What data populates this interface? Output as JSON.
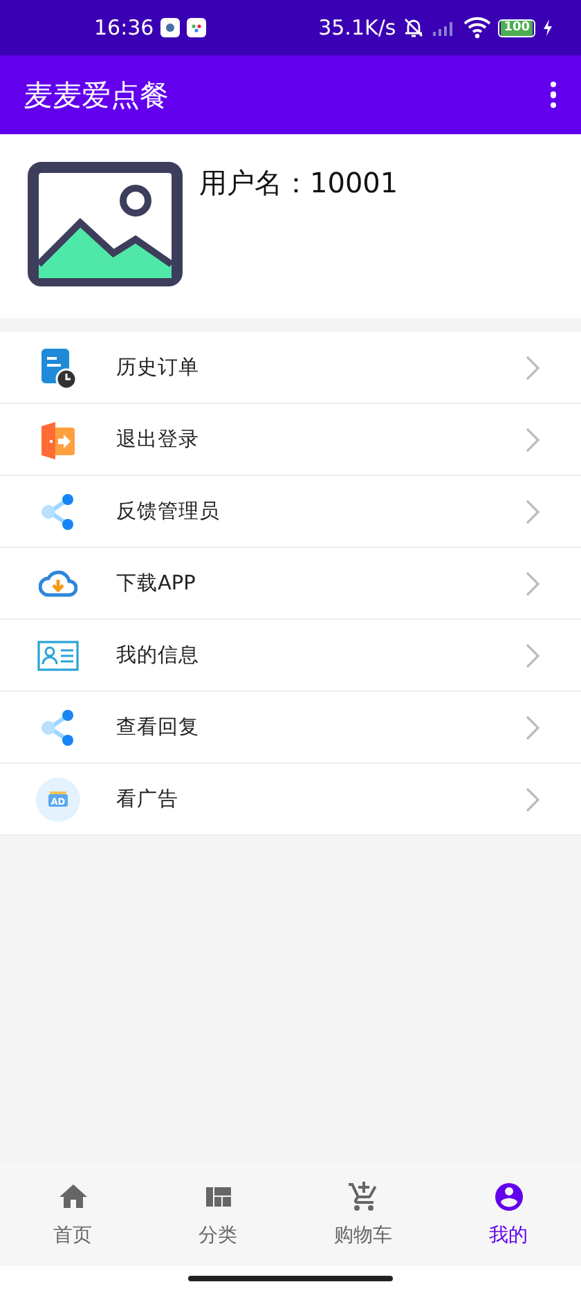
{
  "status_bar": {
    "time": "16:36",
    "speed": "35.1K/s",
    "battery": "100"
  },
  "app_bar": {
    "title": "麦麦爱点餐"
  },
  "profile": {
    "username": "用户名：10001"
  },
  "menu": [
    {
      "label": "历史订单"
    },
    {
      "label": "退出登录"
    },
    {
      "label": "反馈管理员"
    },
    {
      "label": "下载APP"
    },
    {
      "label": "我的信息"
    },
    {
      "label": "查看回复"
    },
    {
      "label": "看广告",
      "icon_text": "AD"
    }
  ],
  "bottom_nav": [
    {
      "label": "首页",
      "selected": false
    },
    {
      "label": "分类",
      "selected": false
    },
    {
      "label": "购物车",
      "selected": false
    },
    {
      "label": "我的",
      "selected": true
    }
  ]
}
